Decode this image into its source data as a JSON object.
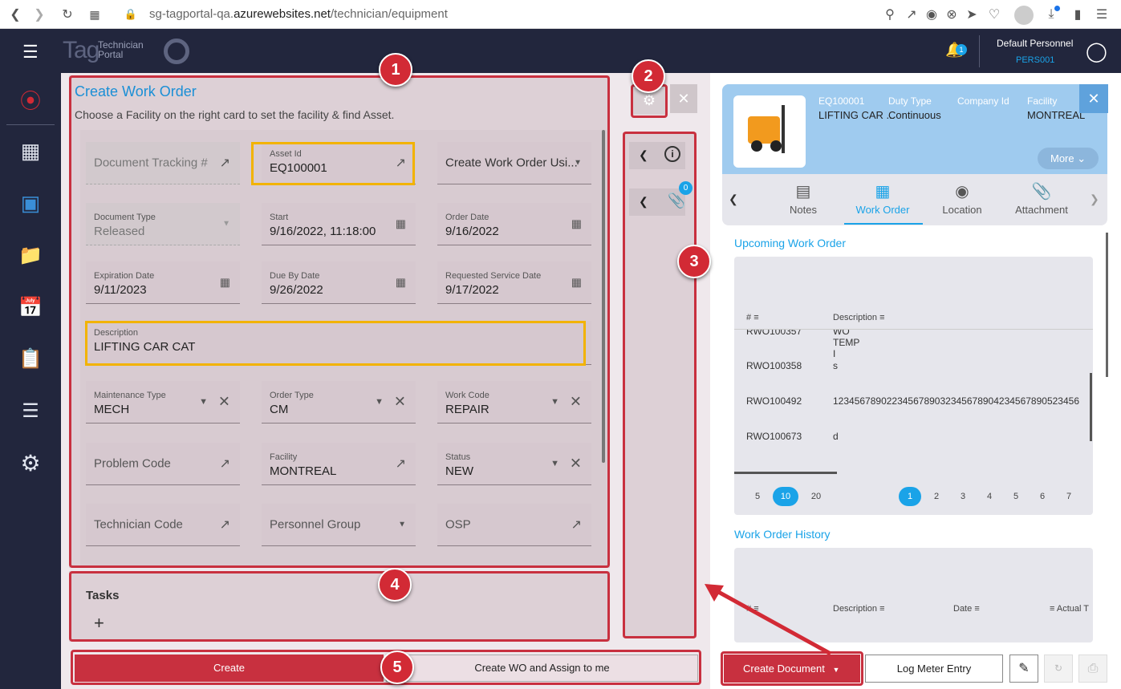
{
  "browser": {
    "url_pre": "sg-tagportal-qa.",
    "url_host": "azurewebsites.net",
    "url_path": "/technician/equipment"
  },
  "header": {
    "logo_tag": "Tag",
    "logo_line1": "Technician",
    "logo_line2": "Portal",
    "notif_count": "1",
    "user_name": "Default Personnel",
    "user_id": "PERS001"
  },
  "form": {
    "title": "Create Work Order",
    "subtitle": "Choose a Facility on the right card to set the facility & find Asset.",
    "doc_tracking": "Document Tracking #",
    "asset_label": "Asset Id",
    "asset_value": "EQ100001",
    "create_using": "Create Work Order Usi...",
    "doc_type_label": "Document Type",
    "doc_type_value": "Released",
    "start_label": "Start",
    "start_value": "9/16/2022, 11:18:00",
    "order_date_label": "Order Date",
    "order_date_value": "9/16/2022",
    "exp_label": "Expiration Date",
    "exp_value": "9/11/2023",
    "due_label": "Due By Date",
    "due_value": "9/26/2022",
    "req_label": "Requested Service Date",
    "req_value": "9/17/2022",
    "desc_label": "Description",
    "desc_value": "LIFTING CAR CAT",
    "maint_label": "Maintenance Type",
    "maint_value": "MECH",
    "order_type_label": "Order Type",
    "order_type_value": "CM",
    "work_code_label": "Work Code",
    "work_code_value": "REPAIR",
    "problem_code": "Problem Code",
    "facility_label": "Facility",
    "facility_value": "MONTREAL",
    "status_label": "Status",
    "status_value": "NEW",
    "tech_code": "Technician Code",
    "personnel_group": "Personnel Group",
    "osp": "OSP"
  },
  "tasks": {
    "title": "Tasks",
    "add": "+"
  },
  "actions": {
    "create": "Create",
    "create_assign": "Create WO and Assign to me"
  },
  "side_panel": {
    "attach_count": "0"
  },
  "markers": [
    "1",
    "2",
    "3",
    "4",
    "5"
  ],
  "asset_card": {
    "id": "EQ100001",
    "name": "LIFTING CAR ...",
    "duty_label": "Duty Type",
    "duty_value": "Continuous",
    "company_label": "Company Id",
    "facility_label": "Facility",
    "facility_value": "MONTREAL",
    "more": "More"
  },
  "tabs": [
    "Notes",
    "Work Order",
    "Location",
    "Attachment"
  ],
  "upcoming": {
    "title": "Upcoming Work Order",
    "col_num": "#",
    "col_desc": "Description",
    "rows": [
      {
        "id": "RWO100357",
        "desc": "WO TEMP I"
      },
      {
        "id": "RWO100358",
        "desc": "s"
      },
      {
        "id": "RWO100492",
        "desc": "1234567890223456789032345678904234567890523456"
      },
      {
        "id": "RWO100673",
        "desc": "d"
      }
    ],
    "page_sizes": [
      "5",
      "10",
      "20"
    ],
    "pages": [
      "1",
      "2",
      "3",
      "4",
      "5",
      "6",
      "7"
    ]
  },
  "history": {
    "title": "Work Order History",
    "col_num": "#",
    "col_desc": "Description",
    "col_date": "Date",
    "col_actual": "Actual T"
  },
  "footer": {
    "create_doc": "Create Document",
    "log_meter": "Log Meter Entry"
  },
  "colors": {
    "accent": "#1aa3e8",
    "navy": "#22263d",
    "red": "#c8303f",
    "yellow": "#f2b300"
  }
}
